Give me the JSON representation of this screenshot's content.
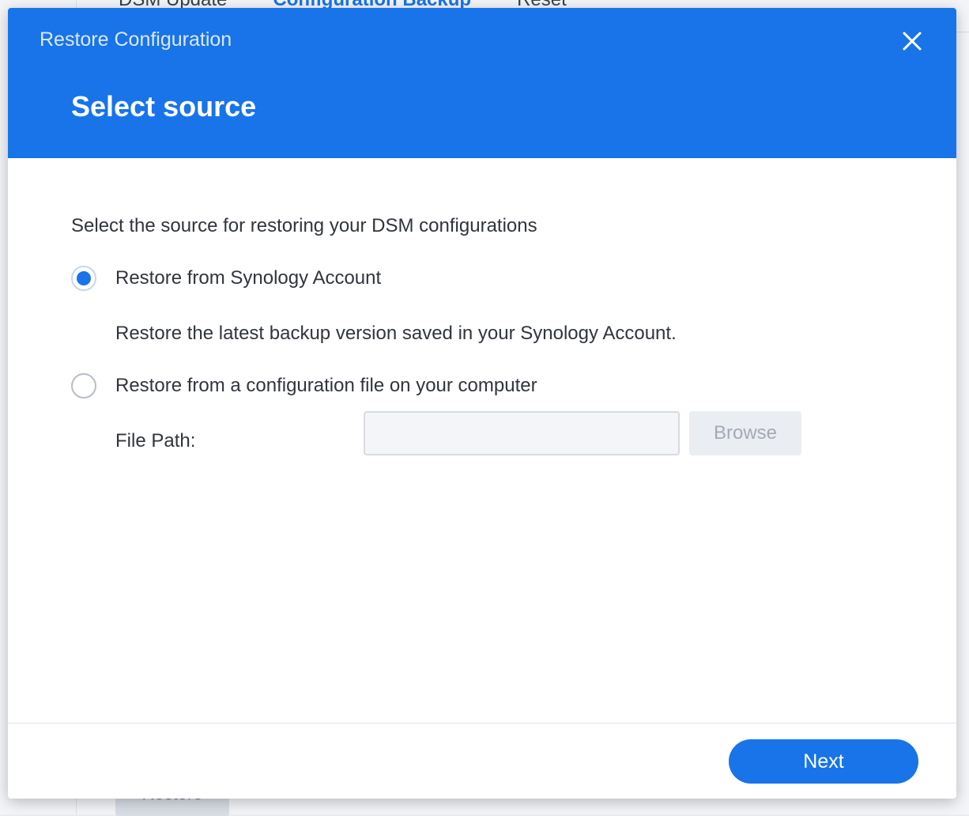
{
  "background": {
    "tabs": [
      "DSM Update",
      "Configuration Backup",
      "Reset"
    ],
    "active_tab_index": 1,
    "restore_button_label": "Restore"
  },
  "dialog": {
    "window_title": "Restore Configuration",
    "close_icon": "close-icon",
    "step_title": "Select source",
    "instruction": "Select the source for restoring your DSM configurations",
    "options": [
      {
        "label": "Restore from Synology Account",
        "checked": true,
        "description": "Restore the latest backup version saved in your Synology Account."
      },
      {
        "label": "Restore from a configuration file on your computer",
        "checked": false
      }
    ],
    "file_path": {
      "label": "File Path:",
      "value": "",
      "browse_label": "Browse"
    },
    "next_label": "Next"
  },
  "colors": {
    "accent": "#1874e8",
    "header_bg": "#1874e8",
    "text": "#30353d",
    "disabled_text": "#a4aab5"
  }
}
